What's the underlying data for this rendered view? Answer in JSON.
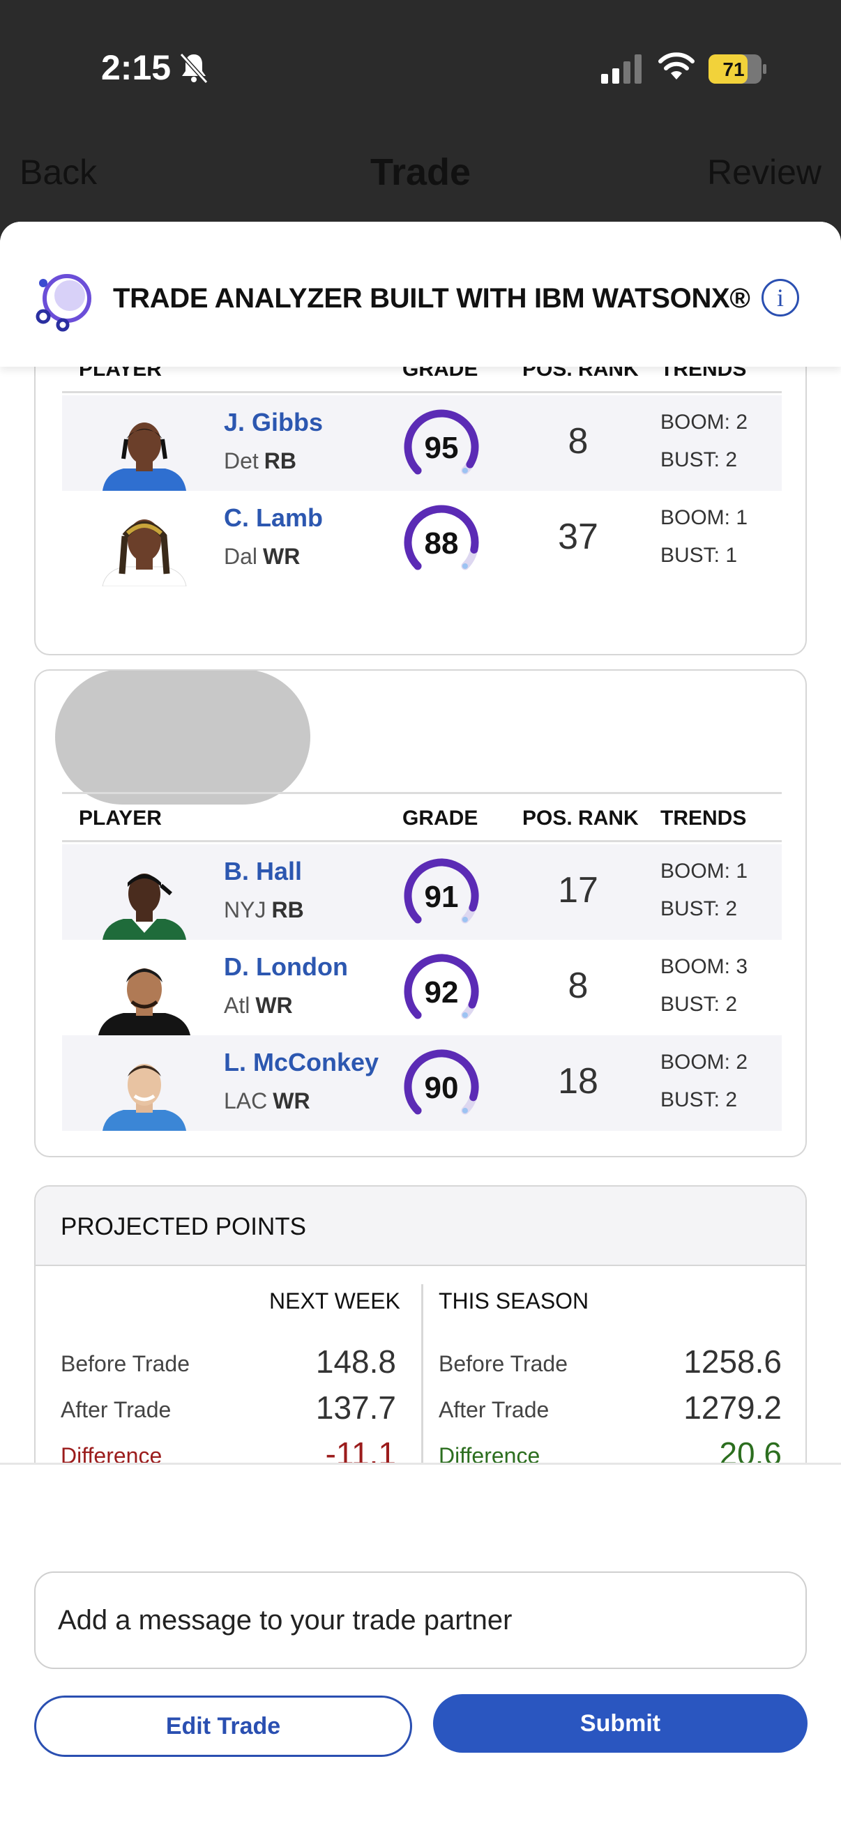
{
  "status_bar": {
    "time": "2:15",
    "battery": "71"
  },
  "nav": {
    "back": "Back",
    "title": "Trade",
    "review": "Review"
  },
  "analyzer": {
    "title": "TRADE ANALYZER BUILT WITH IBM WATSONX®",
    "info_symbol": "i"
  },
  "table_headers": {
    "player": "PLAYER",
    "grade": "GRADE",
    "rank": "POS. RANK",
    "trends": "TRENDS"
  },
  "team1": {
    "players": [
      {
        "name": "J. Gibbs",
        "team": "Det",
        "pos": "RB",
        "grade": "95",
        "grade_frac": 0.95,
        "rank": "8",
        "boom": "BOOM: 2",
        "bust": "BUST: 2"
      },
      {
        "name": "C. Lamb",
        "team": "Dal",
        "pos": "WR",
        "grade": "88",
        "grade_frac": 0.88,
        "rank": "37",
        "boom": "BOOM: 1",
        "bust": "BUST: 1"
      }
    ]
  },
  "team2": {
    "players": [
      {
        "name": "B. Hall",
        "team": "NYJ",
        "pos": "RB",
        "grade": "91",
        "grade_frac": 0.91,
        "rank": "17",
        "boom": "BOOM: 1",
        "bust": "BUST: 2"
      },
      {
        "name": "D. London",
        "team": "Atl",
        "pos": "WR",
        "grade": "92",
        "grade_frac": 0.92,
        "rank": "8",
        "boom": "BOOM: 3",
        "bust": "BUST: 2"
      },
      {
        "name": "L. McConkey",
        "team": "LAC",
        "pos": "WR",
        "grade": "90",
        "grade_frac": 0.9,
        "rank": "18",
        "boom": "BOOM: 2",
        "bust": "BUST: 2"
      }
    ]
  },
  "projected": {
    "title": "PROJECTED POINTS",
    "next_week": {
      "header": "NEXT WEEK",
      "before_label": "Before Trade",
      "before": "148.8",
      "after_label": "After Trade",
      "after": "137.7",
      "diff_label": "Difference",
      "diff": "-11.1"
    },
    "this_season": {
      "header": "THIS SEASON",
      "before_label": "Before Trade",
      "before": "1258.6",
      "after_label": "After Trade",
      "after": "1279.2",
      "diff_label": "Difference",
      "diff": "20.6"
    }
  },
  "message": {
    "placeholder": "Add a message to your trade partner"
  },
  "buttons": {
    "edit": "Edit Trade",
    "submit": "Submit"
  },
  "colors": {
    "accent": "#2a56c0",
    "grade_purple": "#5b2bb5",
    "negative": "#9b1c1c",
    "positive": "#2c6e1f"
  }
}
